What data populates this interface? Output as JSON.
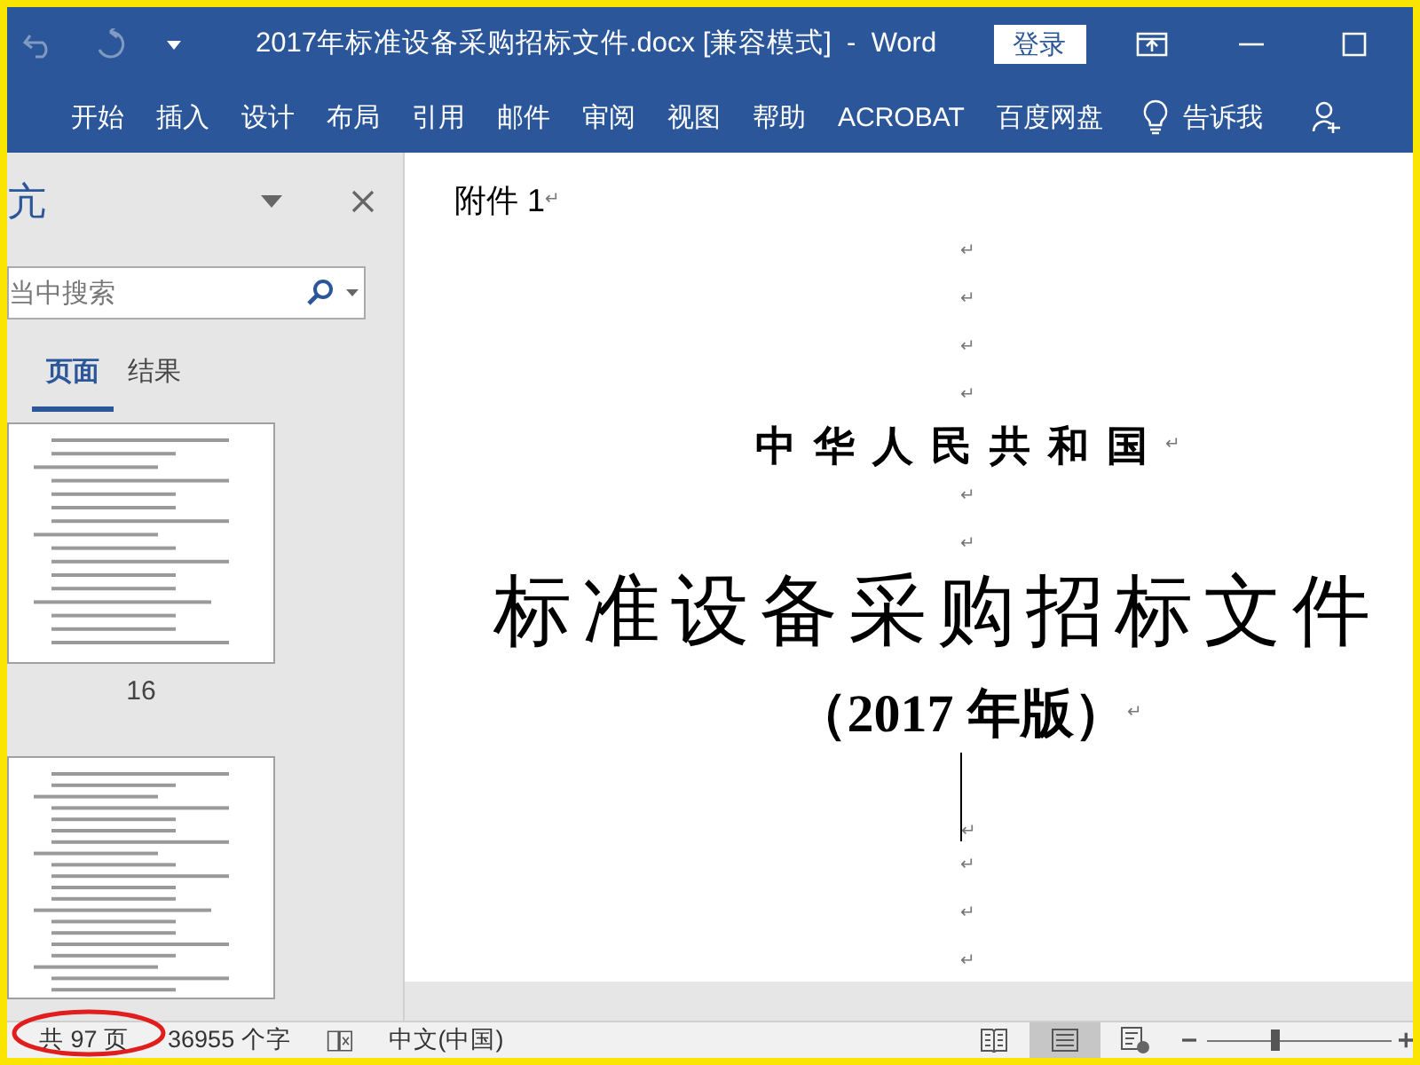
{
  "window": {
    "title": "2017年标准设备采购招标文件.docx [兼容模式]  -  Word",
    "sign_in": "登录"
  },
  "ribbon": {
    "tabs": [
      {
        "label": "开始"
      },
      {
        "label": "插入"
      },
      {
        "label": "设计"
      },
      {
        "label": "布局"
      },
      {
        "label": "引用"
      },
      {
        "label": "邮件"
      },
      {
        "label": "审阅"
      },
      {
        "label": "视图"
      },
      {
        "label": "帮助"
      },
      {
        "label": "ACROBAT"
      },
      {
        "label": "百度网盘"
      }
    ],
    "tell_me": "告诉我"
  },
  "nav_pane": {
    "title": "亢",
    "search": {
      "placeholder": "当中搜索"
    },
    "tabs": [
      {
        "label": "页面",
        "selected": true
      },
      {
        "label": "结果",
        "selected": false
      }
    ],
    "thumbnails": [
      {
        "kind": "full",
        "label": "16"
      },
      {
        "kind": "partial"
      }
    ]
  },
  "document": {
    "paragraphs": [
      {
        "kind": "body",
        "text": "附件 1",
        "mark": "↵"
      },
      {
        "kind": "empty",
        "mark": "↵"
      },
      {
        "kind": "empty",
        "mark": "↵"
      },
      {
        "kind": "empty",
        "mark": "↵"
      },
      {
        "kind": "empty",
        "mark": "↵"
      },
      {
        "kind": "heading",
        "text": "中华人民共和国",
        "mark": "↵"
      },
      {
        "kind": "empty",
        "mark": "↵"
      },
      {
        "kind": "empty",
        "mark": "↵"
      },
      {
        "kind": "title",
        "text": "标准设备采购招标文件"
      },
      {
        "kind": "subtitle",
        "text": "（2017 年版）",
        "mark": "↵"
      },
      {
        "kind": "cursor",
        "mark": "↵"
      },
      {
        "kind": "empty",
        "mark": "↵"
      },
      {
        "kind": "empty",
        "mark": "↵"
      },
      {
        "kind": "empty",
        "mark": "↵"
      }
    ]
  },
  "status_bar": {
    "page_count": "共 97 页",
    "word_count": "36955 个字",
    "language": "中文(中国)",
    "views": [
      {
        "kind": "read",
        "selected": false
      },
      {
        "kind": "print",
        "selected": true
      },
      {
        "kind": "web",
        "selected": false
      }
    ],
    "zoom": {
      "level": 0.37
    },
    "annotation": {
      "kind": "ellipse"
    }
  }
}
